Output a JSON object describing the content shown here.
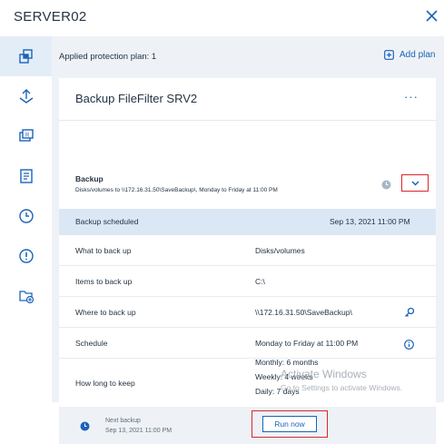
{
  "header": {
    "title": "SERVER02"
  },
  "sidebar": {
    "items": [
      {
        "icon": "protection-icon",
        "active": true
      },
      {
        "icon": "recovery-icon"
      },
      {
        "icon": "restore-icon"
      },
      {
        "icon": "report-icon"
      },
      {
        "icon": "history-icon"
      },
      {
        "icon": "alert-icon"
      },
      {
        "icon": "folder-add-icon"
      }
    ]
  },
  "plan_bar": {
    "label": "Applied protection plan: 1",
    "add_label": "Add plan"
  },
  "card": {
    "title": "Backup FileFilter SRV2",
    "more_label": "···",
    "backup": {
      "name": "Backup",
      "description": "Disks/volumes to \\\\172.16.31.50\\SaveBackup\\, Monday to Friday at 11:00 PM"
    },
    "status": {
      "label": "Backup scheduled",
      "value": "Sep 13, 2021 11:00 PM"
    },
    "rows": [
      {
        "label": "What to back up",
        "value": "Disks/volumes"
      },
      {
        "label": "Items to back up",
        "value": "C:\\"
      },
      {
        "label": "Where to back up",
        "value": "\\\\172.16.31.50\\SaveBackup\\"
      },
      {
        "label": "Schedule",
        "value": "Monday to Friday at 11:00 PM"
      },
      {
        "label": "How long to keep",
        "lines": [
          "Monthly: 6 months",
          "Weekly: 4 weeks",
          "Daily: 7 days"
        ]
      }
    ]
  },
  "footer": {
    "next_label": "Next backup",
    "next_date": "Sep 13, 2021 11:00 PM",
    "run_label": "Run now"
  },
  "watermark": {
    "title": "Activate Windows",
    "subtitle": "Go to Settings to activate Windows."
  },
  "colors": {
    "accent": "#1b63b8",
    "highlight": "#d9272e",
    "status_bg": "#dbe7f5"
  }
}
